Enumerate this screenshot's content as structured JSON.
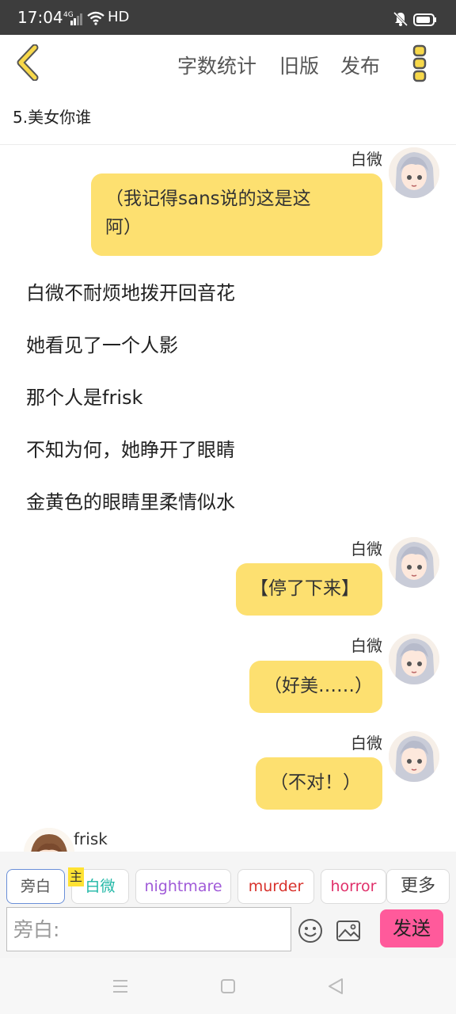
{
  "status_bar": {
    "time": "17:04",
    "network": "4G",
    "hd": "HD"
  },
  "topbar": {
    "word_count": "字数统计",
    "old_version": "旧版",
    "publish": "发布"
  },
  "chapter": {
    "title": "5.美女你谁"
  },
  "messages": [
    {
      "type": "bubble",
      "speaker": "白微",
      "text_line1": "（我记得sans说的这是这",
      "text_line2": "阿）"
    },
    {
      "type": "narration",
      "text": "白微不耐烦地拨开回音花"
    },
    {
      "type": "narration",
      "text": "她看见了一个人影"
    },
    {
      "type": "narration",
      "text": "那个人是frisk"
    },
    {
      "type": "narration",
      "text": "不知为何，她睁开了眼睛"
    },
    {
      "type": "narration",
      "text": "金黄色的眼睛里柔情似水"
    },
    {
      "type": "bubble",
      "speaker": "白微",
      "text": "【停了下来】"
    },
    {
      "type": "bubble",
      "speaker": "白微",
      "text": "（好美……）"
    },
    {
      "type": "bubble",
      "speaker": "白微",
      "text": "（不对！）"
    },
    {
      "type": "bubble-left",
      "speaker": "frisk"
    }
  ],
  "roles": {
    "narrator": "旁白",
    "main_badge": "主",
    "baiwei": "白微",
    "nightmare": "nightmare",
    "murder": "murder",
    "horror": "horror",
    "more": "更多"
  },
  "composer": {
    "placeholder": "旁白:",
    "send": "发送"
  },
  "colors": {
    "bubble": "#fde070",
    "send": "#ff5a9b",
    "accent_icon": "#c8a800",
    "baiwei": "#1fb7a6",
    "nightmare": "#a05ad8",
    "murder": "#d8322c",
    "horror": "#e0306a"
  }
}
